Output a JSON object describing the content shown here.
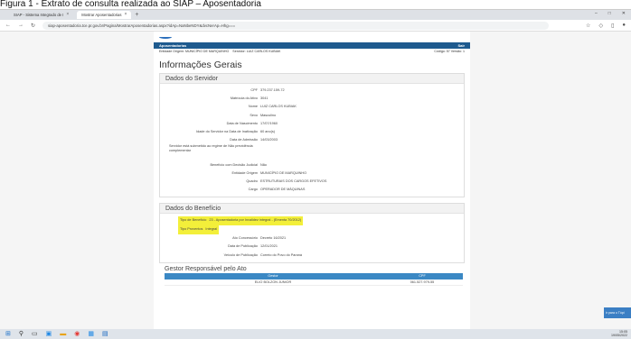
{
  "caption": "Figura 1 - Extrato de consulta realizada ao SIAP – Aposentadoria",
  "browser": {
    "tabs": [
      {
        "label": "SIAP - Sistema Integrado de I"
      },
      {
        "label": "Mostrar Aposentadorias"
      }
    ],
    "url": "siap-aposentadoria.tce.pr.gov.br/Pagina/MostrarAposentadorias.aspx?idAp=NaNbeNDY&dvcNerAp=Hhg==="
  },
  "header": {
    "bar_left": "Aposentadorias",
    "bar_right": "Sair",
    "entidade_label": "Entidade Origem:",
    "entidade_value": "MUNICÍPIO DE MARQUINHO",
    "servidor_label": "Servidor:",
    "servidor_value": "LUIZ CARLOS KUBIAK",
    "codigo": "Código: 57 Versão: 1"
  },
  "page_title": "Informações Gerais",
  "servidor_section": {
    "title": "Dados do Servidor",
    "fields": [
      {
        "label": "CPF",
        "value": "379.237.159-72"
      },
      {
        "label": "Matrícula do Ativo",
        "value": "3041"
      },
      {
        "label": "Nome",
        "value": "LUIZ CARLOS KUBIAK"
      },
      {
        "label": "Sexo",
        "value": "Masculino"
      },
      {
        "label": "Data de Nascimento",
        "value": "17/07/1960"
      },
      {
        "label": "Idade do Servidor na Data de Inativação",
        "value": "60 ano(s)"
      },
      {
        "label": "Data de Admissão",
        "value": "14/03/2003"
      },
      {
        "label": "Servidor está submetido ao regime de Não previdência complementar",
        "value": ""
      },
      {
        "label": "Benefício com Decisão Judicial",
        "value": "Não"
      },
      {
        "label": "Entidade Origem",
        "value": "MUNICÍPIO DE MARQUINHO"
      },
      {
        "label": "Quadro",
        "value": "ESTRUTURAIS DOS CARGOS EFETIVOS"
      },
      {
        "label": "Cargo",
        "value": "OPERADOR DE MÁQUINAS"
      }
    ]
  },
  "beneficio_section": {
    "title": "Dados do Benefício",
    "fields": [
      {
        "label": "Tipo de Benefício",
        "value": "23 - Aposentadoria por Invalidez integral - (Ementa 70/2012)",
        "highlight": true
      },
      {
        "label": "Tipo Proventos",
        "value": "Integral",
        "highlight": true
      },
      {
        "label": "Ato Concessório",
        "value": "Decreto 16/2021",
        "highlight": false
      },
      {
        "label": "Data de Publicação",
        "value": "12/01/2021",
        "highlight": false
      },
      {
        "label": "Veículo de Publicação",
        "value": "Correio do Povo do Paraná",
        "highlight": false
      }
    ]
  },
  "gestor_section": {
    "title": "Gestor Responsável pelo Ato",
    "columns": [
      "Gestor",
      "CPF"
    ],
    "rows": [
      {
        "gestor": "ELIO BOLZON JUNIOR",
        "cpf": "061.527.979-55"
      }
    ]
  },
  "notification": "ir para o Tópi",
  "clock": {
    "time": "15:05",
    "date": "19/05/2022"
  }
}
